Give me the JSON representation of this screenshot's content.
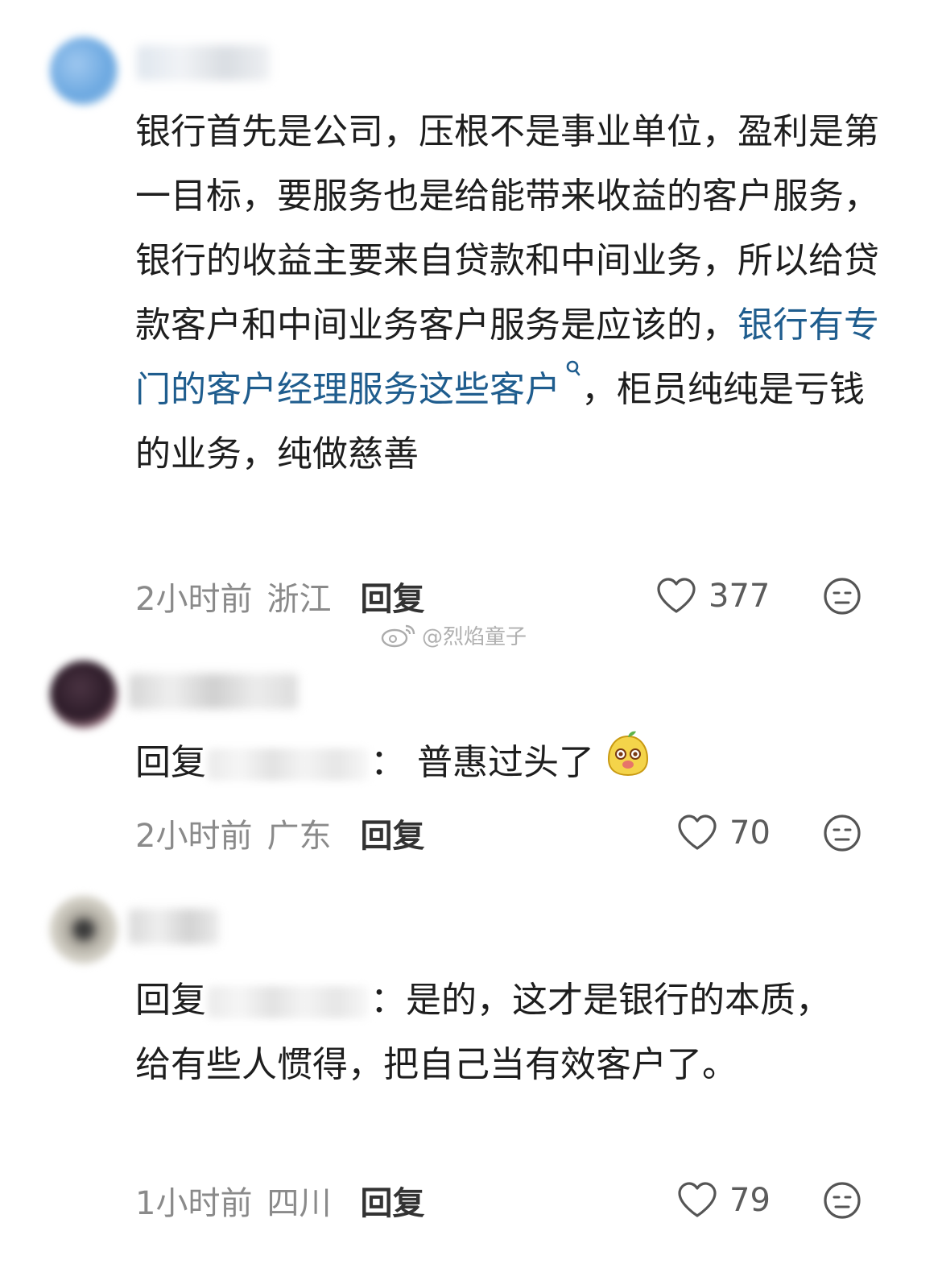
{
  "comments": [
    {
      "text_parts": [
        "银行首先是公司，压根不是事业单位，盈利是第一目标，要服务也是给能带来收益的客户服务，银行的收益主要来自贷款和中间业务，所以给贷款客户和中间业务客户服务是应该的，"
      ],
      "link_text": "银行有专门的客户经理服务这些客户",
      "text_after_link": "，柜员纯纯是亏钱的业务，纯做慈善",
      "time": "2小时前",
      "location": "浙江",
      "reply_label": "回复",
      "likes": "377"
    },
    {
      "reply_prefix": "回复",
      "reply_sep": "：",
      "text": "普惠过头了",
      "time": "2小时前",
      "location": "广东",
      "reply_label": "回复",
      "likes": "70"
    },
    {
      "reply_prefix": "回复",
      "reply_sep": "：",
      "text": "是的，这才是银行的本质，给有些人惯得，把自己当有效客户了。",
      "time": "1小时前",
      "location": "四川",
      "reply_label": "回复",
      "likes": "79"
    }
  ],
  "watermark": "@烈焰童子",
  "icons": {
    "like": "heart-outline-icon",
    "dislike": "neutral-face-icon",
    "emoji": "mango-sticker-emoji",
    "watermark": "weibo-logo-icon",
    "search": "search-magnifier-icon"
  },
  "colors": {
    "link": "#1f5d8e",
    "meta": "#8a8a8a",
    "text": "#1e1e1e"
  }
}
